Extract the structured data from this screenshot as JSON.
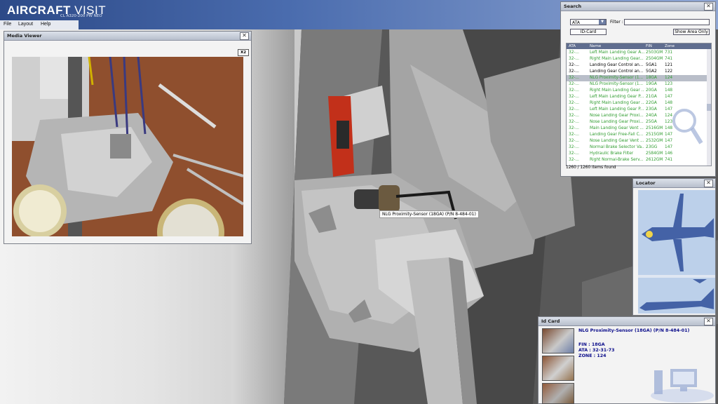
{
  "app": {
    "title_a": "AIRCRAFT",
    "title_b": "VISIT",
    "subtitle": "CL A320-200 PW NEO",
    "menu": [
      "File",
      "Layout",
      "Help"
    ]
  },
  "scene": {
    "tooltip": "NLG Proximity-Sensor (18GA) (P/N 8-484-01)"
  },
  "media_viewer": {
    "title": "Media Viewer",
    "zoom_label": "X2"
  },
  "search": {
    "title": "Search",
    "select_value": "ATA",
    "filter_label": "Filter :",
    "filter_value": "",
    "idcard_button": "ID-Card",
    "show_area_button": "Show Area Only",
    "columns": [
      "ATA",
      "Name",
      "FIN",
      "Zone"
    ],
    "rows": [
      {
        "ata": "32-...",
        "name": "Left Main Landing Gear A...",
        "fin": "2503GM",
        "zone": "731",
        "color": "#2f9c2f"
      },
      {
        "ata": "32-...",
        "name": "Right Main Landing Gear...",
        "fin": "2504GM",
        "zone": "741",
        "color": "#2f9c2f"
      },
      {
        "ata": "32-...",
        "name": "Landing Gear Control an...",
        "fin": "5GA1",
        "zone": "121",
        "color": "#000000"
      },
      {
        "ata": "32-...",
        "name": "Landing Gear Control an...",
        "fin": "5GA2",
        "zone": "122",
        "color": "#000000"
      },
      {
        "ata": "32-...",
        "name": "NLG Proximity-Sensor (1...",
        "fin": "18GA",
        "zone": "124",
        "color": "#2f9c2f",
        "selected": true
      },
      {
        "ata": "32-...",
        "name": "NLG Proximity-Sensor (1...",
        "fin": "19GA",
        "zone": "123",
        "color": "#2f9c2f"
      },
      {
        "ata": "32-...",
        "name": "Right Main Landing Gear ...",
        "fin": "20GA",
        "zone": "148",
        "color": "#2f9c2f"
      },
      {
        "ata": "32-...",
        "name": "Left Main Landing Gear P...",
        "fin": "21GA",
        "zone": "147",
        "color": "#2f9c2f"
      },
      {
        "ata": "32-...",
        "name": "Right Main Landing Gear ...",
        "fin": "22GA",
        "zone": "148",
        "color": "#2f9c2f"
      },
      {
        "ata": "32-...",
        "name": "Left Main Landing Gear P...",
        "fin": "23GA",
        "zone": "147",
        "color": "#2f9c2f"
      },
      {
        "ata": "32-...",
        "name": "Nose Landing Gear Proxi...",
        "fin": "24GA",
        "zone": "124",
        "color": "#2f9c2f"
      },
      {
        "ata": "32-...",
        "name": "Nose Landing Gear Proxi...",
        "fin": "25GA",
        "zone": "123",
        "color": "#2f9c2f"
      },
      {
        "ata": "32-...",
        "name": "Main Landing Gear Vent ...",
        "fin": "2516GM",
        "zone": "148",
        "color": "#2f9c2f"
      },
      {
        "ata": "32-...",
        "name": "Landing Gear Free-Fall C...",
        "fin": "2515GM",
        "zone": "147",
        "color": "#2f9c2f"
      },
      {
        "ata": "32-...",
        "name": "Nose Landing Gear Vent ...",
        "fin": "2532GM",
        "zone": "147",
        "color": "#2f9c2f"
      },
      {
        "ata": "32-...",
        "name": "Normal Brake Selector Va...",
        "fin": "23GG",
        "zone": "147",
        "color": "#2f9c2f"
      },
      {
        "ata": "32-...",
        "name": "Hydraulic Brake Filter",
        "fin": "2584GM",
        "zone": "146",
        "color": "#2f9c2f"
      },
      {
        "ata": "32-...",
        "name": "Right Normal-Brake Serv...",
        "fin": "2612GM",
        "zone": "741",
        "color": "#2f9c2f"
      }
    ],
    "count": "1260 / 1260 items found"
  },
  "locator": {
    "title": "Locator"
  },
  "id_card": {
    "title": "Id Card",
    "part_title": "NLG Proximity-Sensor (18GA) (P/N 8-484-01)",
    "fin": "FIN : 18GA",
    "ata": "ATA : 32-31-73",
    "zone": "ZONE : 124"
  },
  "colors": {
    "header_dark": "#2d4a88",
    "header_light": "#8fa6d3",
    "grid_header": "#5f6d8f",
    "selected_row": "#b9bec9",
    "green_text": "#2f9c2f",
    "id_text": "#0a0c8a",
    "connector_red": "#c2301a"
  }
}
